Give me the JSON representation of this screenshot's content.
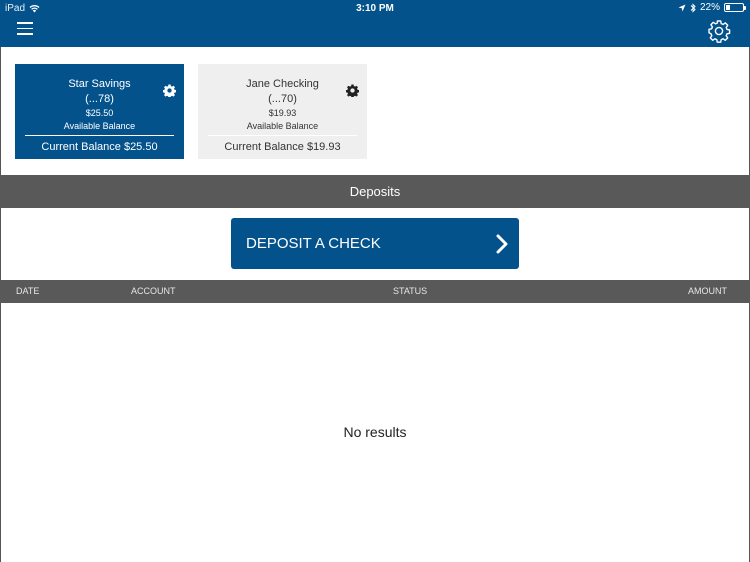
{
  "status_bar": {
    "device": "iPad",
    "time": "3:10 PM",
    "battery": "22%",
    "battery_level": 0.22,
    "icons": [
      "wifi-icon",
      "location-icon",
      "bluetooth-icon",
      "battery-icon"
    ]
  },
  "nav": {
    "menu_icon": "hamburger-icon",
    "settings_icon": "gear-icon"
  },
  "accounts": [
    {
      "name": "Star Savings",
      "number": "(...78)",
      "available_amount": "$25.50",
      "available_label": "Available Balance",
      "current_balance": "Current Balance $25.50",
      "selected": true
    },
    {
      "name": "Jane Checking",
      "number": "(...70)",
      "available_amount": "$19.93",
      "available_label": "Available Balance",
      "current_balance": "Current Balance $19.93",
      "selected": false
    }
  ],
  "deposits": {
    "title": "Deposits",
    "button_label": "DEPOSIT A CHECK",
    "columns": [
      "DATE",
      "ACCOUNT",
      "STATUS",
      "AMOUNT"
    ],
    "rows": [],
    "empty_text": "No results"
  },
  "colors": {
    "brand": "#03528c",
    "section_header": "#595959",
    "card_inactive": "#efefef"
  }
}
